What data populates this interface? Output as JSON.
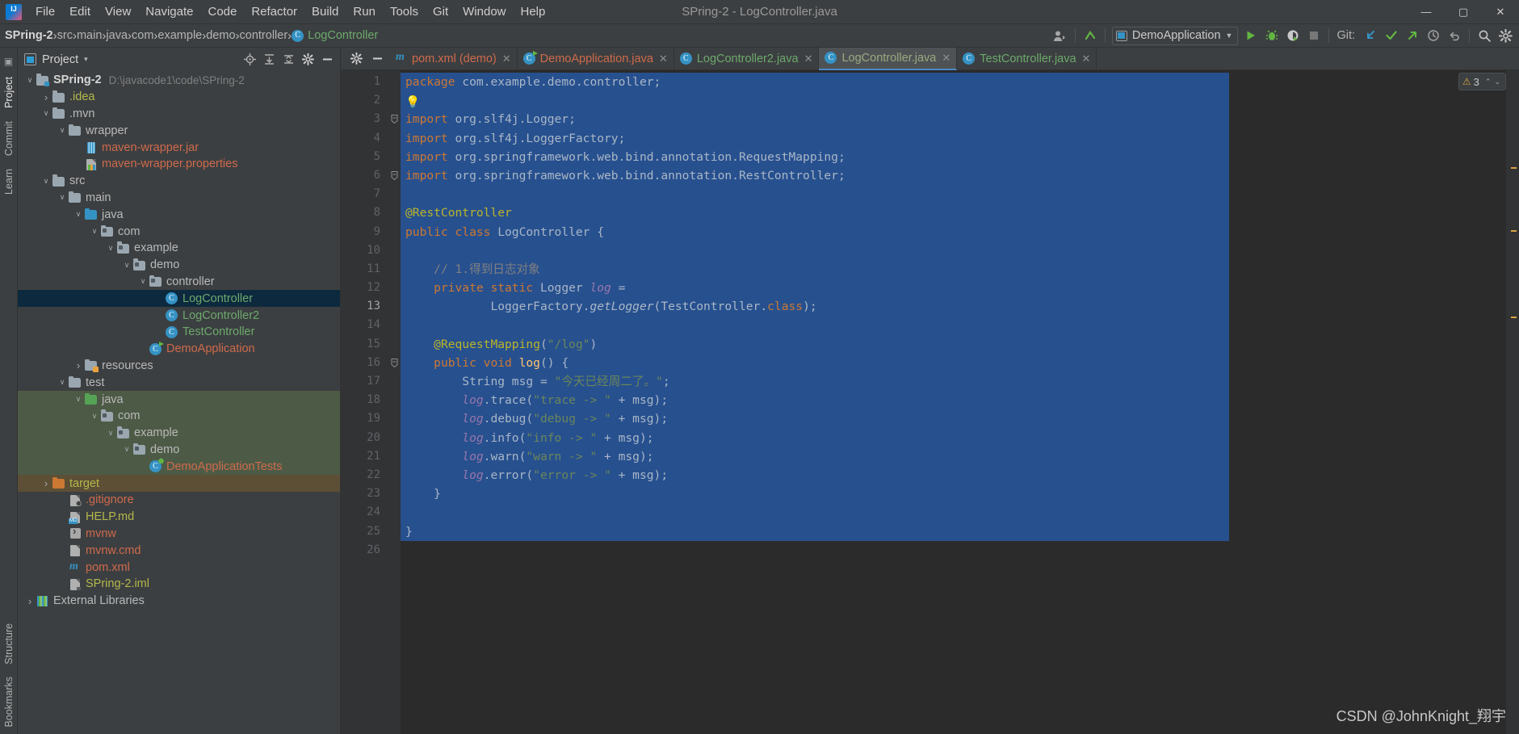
{
  "window": {
    "title": "SPring-2 - LogController.java",
    "minimize": "—",
    "maximize": "▢",
    "close": "✕"
  },
  "menubar": {
    "logo": "intellij-logo-icon",
    "items": [
      "File",
      "Edit",
      "View",
      "Navigate",
      "Code",
      "Refactor",
      "Build",
      "Run",
      "Tools",
      "Git",
      "Window",
      "Help"
    ]
  },
  "navbar": {
    "breadcrumbs": [
      "SPring-2",
      "src",
      "main",
      "java",
      "com",
      "example",
      "demo",
      "controller",
      "LogController"
    ],
    "separator": "›",
    "run_config": "DemoApplication",
    "git_label": "Git:",
    "icons": {
      "user": "user-avatar-icon",
      "updates": "updates-icon",
      "run": "run-icon",
      "debug": "debug-icon",
      "run_coverage": "run-with-coverage-icon",
      "stop": "stop-icon",
      "pull": "git-pull-icon",
      "commit": "git-commit-icon",
      "push": "git-push-icon",
      "history": "git-history-icon",
      "rollback": "git-rollback-icon",
      "search": "search-icon",
      "settings": "settings-gear-icon"
    }
  },
  "left_strip": {
    "top": [
      "Project",
      "Commit",
      "Learn"
    ],
    "bottom": [
      "Structure",
      "Bookmarks"
    ]
  },
  "project_panel": {
    "title": "Project",
    "caret": "▾",
    "header_icons": [
      "locate-icon",
      "expand-all-icon",
      "collapse-all-icon",
      "settings-gear-icon",
      "hide-icon"
    ],
    "tree": [
      {
        "depth": 0,
        "arrow": "⌄",
        "icon": "module-folder",
        "label": "SPring-2",
        "path": "D:\\javacode1\\code\\SPring-2",
        "color": "#d4d4d4",
        "bold": true,
        "state": "normal"
      },
      {
        "depth": 1,
        "arrow": "›",
        "icon": "folder",
        "label": ".idea",
        "path": "",
        "color": "#b5b84a",
        "bold": false,
        "state": "normal"
      },
      {
        "depth": 1,
        "arrow": "⌄",
        "icon": "folder",
        "label": ".mvn",
        "path": "",
        "color": "#b9b9b9",
        "bold": false,
        "state": "normal"
      },
      {
        "depth": 2,
        "arrow": "⌄",
        "icon": "folder",
        "label": "wrapper",
        "path": "",
        "color": "#b9b9b9",
        "bold": false,
        "state": "normal"
      },
      {
        "depth": 3,
        "arrow": "",
        "icon": "jar-file",
        "label": "maven-wrapper.jar",
        "path": "",
        "color": "#cf6a4c",
        "bold": false,
        "state": "normal"
      },
      {
        "depth": 3,
        "arrow": "",
        "icon": "properties-file",
        "label": "maven-wrapper.properties",
        "path": "",
        "color": "#cf6a4c",
        "bold": false,
        "state": "normal"
      },
      {
        "depth": 1,
        "arrow": "⌄",
        "icon": "folder",
        "label": "src",
        "path": "",
        "color": "#b9b9b9",
        "bold": false,
        "state": "normal"
      },
      {
        "depth": 2,
        "arrow": "⌄",
        "icon": "folder",
        "label": "main",
        "path": "",
        "color": "#b9b9b9",
        "bold": false,
        "state": "normal"
      },
      {
        "depth": 3,
        "arrow": "⌄",
        "icon": "source-folder",
        "label": "java",
        "path": "",
        "color": "#b9b9b9",
        "bold": false,
        "state": "normal"
      },
      {
        "depth": 4,
        "arrow": "⌄",
        "icon": "package",
        "label": "com",
        "path": "",
        "color": "#b9b9b9",
        "bold": false,
        "state": "normal"
      },
      {
        "depth": 5,
        "arrow": "⌄",
        "icon": "package",
        "label": "example",
        "path": "",
        "color": "#b9b9b9",
        "bold": false,
        "state": "normal"
      },
      {
        "depth": 6,
        "arrow": "⌄",
        "icon": "package",
        "label": "demo",
        "path": "",
        "color": "#b9b9b9",
        "bold": false,
        "state": "normal"
      },
      {
        "depth": 7,
        "arrow": "⌄",
        "icon": "package",
        "label": "controller",
        "path": "",
        "color": "#b9b9b9",
        "bold": false,
        "state": "normal"
      },
      {
        "depth": 8,
        "arrow": "",
        "icon": "java-class",
        "label": "LogController",
        "path": "",
        "color": "#6ca96c",
        "bold": false,
        "state": "selected"
      },
      {
        "depth": 8,
        "arrow": "",
        "icon": "java-class",
        "label": "LogController2",
        "path": "",
        "color": "#6ca96c",
        "bold": false,
        "state": "normal"
      },
      {
        "depth": 8,
        "arrow": "",
        "icon": "java-class",
        "label": "TestController",
        "path": "",
        "color": "#6ca96c",
        "bold": false,
        "state": "normal"
      },
      {
        "depth": 7,
        "arrow": "",
        "icon": "java-class-runnable",
        "label": "DemoApplication",
        "path": "",
        "color": "#cf6a4c",
        "bold": false,
        "state": "normal"
      },
      {
        "depth": 3,
        "arrow": "›",
        "icon": "resources-folder",
        "label": "resources",
        "path": "",
        "color": "#b9b9b9",
        "bold": false,
        "state": "normal"
      },
      {
        "depth": 2,
        "arrow": "⌄",
        "icon": "folder",
        "label": "test",
        "path": "",
        "color": "#b9b9b9",
        "bold": false,
        "state": "normal"
      },
      {
        "depth": 3,
        "arrow": "⌄",
        "icon": "test-source-folder",
        "label": "java",
        "path": "",
        "color": "#b9b9b9",
        "bold": false,
        "state": "testsrc"
      },
      {
        "depth": 4,
        "arrow": "⌄",
        "icon": "package",
        "label": "com",
        "path": "",
        "color": "#b9b9b9",
        "bold": false,
        "state": "testsrc"
      },
      {
        "depth": 5,
        "arrow": "⌄",
        "icon": "package",
        "label": "example",
        "path": "",
        "color": "#b9b9b9",
        "bold": false,
        "state": "testsrc"
      },
      {
        "depth": 6,
        "arrow": "⌄",
        "icon": "package",
        "label": "demo",
        "path": "",
        "color": "#b9b9b9",
        "bold": false,
        "state": "testsrc"
      },
      {
        "depth": 7,
        "arrow": "",
        "icon": "java-test-class",
        "label": "DemoApplicationTests",
        "path": "",
        "color": "#cf6a4c",
        "bold": false,
        "state": "testsrc"
      },
      {
        "depth": 1,
        "arrow": "›",
        "icon": "excluded-folder",
        "label": "target",
        "path": "",
        "color": "#b5b84a",
        "bold": false,
        "state": "target"
      },
      {
        "depth": 2,
        "arrow": "",
        "icon": "gitignore-file",
        "label": ".gitignore",
        "path": "",
        "color": "#cf6a4c",
        "bold": false,
        "state": "normal"
      },
      {
        "depth": 2,
        "arrow": "",
        "icon": "markdown-file",
        "label": "HELP.md",
        "path": "",
        "color": "#b5b84a",
        "bold": false,
        "state": "normal"
      },
      {
        "depth": 2,
        "arrow": "",
        "icon": "shell-file",
        "label": "mvnw",
        "path": "",
        "color": "#cf6a4c",
        "bold": false,
        "state": "normal"
      },
      {
        "depth": 2,
        "arrow": "",
        "icon": "cmd-file",
        "label": "mvnw.cmd",
        "path": "",
        "color": "#cf6a4c",
        "bold": false,
        "state": "normal"
      },
      {
        "depth": 2,
        "arrow": "",
        "icon": "maven-file",
        "label": "pom.xml",
        "path": "",
        "color": "#cf6a4c",
        "bold": false,
        "state": "normal"
      },
      {
        "depth": 2,
        "arrow": "",
        "icon": "iml-file",
        "label": "SPring-2.iml",
        "path": "",
        "color": "#b5b84a",
        "bold": false,
        "state": "normal"
      },
      {
        "depth": 0,
        "arrow": "›",
        "icon": "external-libraries",
        "label": "External Libraries",
        "path": "",
        "color": "#b9b9b9",
        "bold": false,
        "state": "normal"
      }
    ]
  },
  "editor": {
    "lead_icons": [
      "settings-gear-icon",
      "hide-panel-icon"
    ],
    "tabs": [
      {
        "label": "pom.xml (demo)",
        "icon": "maven-file-icon",
        "color": "#cf6a4c",
        "active": false,
        "close": "✕"
      },
      {
        "label": "DemoApplication.java",
        "icon": "java-class-runnable-icon",
        "color": "#cf6a4c",
        "active": false,
        "close": "✕"
      },
      {
        "label": "LogController2.java",
        "icon": "java-class-icon",
        "color": "#6ca96c",
        "active": false,
        "close": "✕"
      },
      {
        "label": "LogController.java",
        "icon": "java-class-icon",
        "color": "#9aa97f",
        "active": true,
        "close": "✕"
      },
      {
        "label": "TestController.java",
        "icon": "java-class-icon",
        "color": "#6ca96c",
        "active": false,
        "close": "✕"
      }
    ],
    "line_numbers": [
      1,
      2,
      3,
      4,
      5,
      6,
      7,
      8,
      9,
      10,
      11,
      12,
      13,
      14,
      15,
      16,
      17,
      18,
      19,
      20,
      21,
      22,
      23,
      24,
      25,
      26
    ],
    "current_line": 13,
    "warnings": {
      "icon": "warning-triangle-icon",
      "count": "3",
      "up": "⌃",
      "down": "⌄"
    },
    "code_lines": [
      {
        "n": 1,
        "html": "<span class='kw'>package</span> <span class='white'>com.example.demo.controller</span><span class='white'>;</span>"
      },
      {
        "n": 2,
        "html": "<span class='bulb'>💡</span>"
      },
      {
        "n": 3,
        "html": "<span class='kw'>import</span> <span class='white'>org.slf4j.Logger;</span>"
      },
      {
        "n": 4,
        "html": "<span class='kw'>import</span> <span class='white'>org.slf4j.LoggerFactory;</span>"
      },
      {
        "n": 5,
        "html": "<span class='kw'>import</span> <span class='white'>org.springframework.web.bind.annotation.RequestMapping;</span>"
      },
      {
        "n": 6,
        "html": "<span class='kw'>import</span> <span class='white'>org.springframework.web.bind.annotation.RestController;</span>"
      },
      {
        "n": 7,
        "html": ""
      },
      {
        "n": 8,
        "html": "<span class='ann'>@RestController</span>"
      },
      {
        "n": 9,
        "html": "<span class='kw'>public class</span> <span class='white'>LogController</span> {"
      },
      {
        "n": 10,
        "html": ""
      },
      {
        "n": 11,
        "html": "    <span class='cmt'>// 1.得到日志对象</span>"
      },
      {
        "n": 12,
        "html": "    <span class='kw'>private static</span> <span class='white'>Logger</span> <span class='fld'>log</span> ="
      },
      {
        "n": 13,
        "html": "            <span class='white'>LoggerFactory.</span><span class='stat'>getLogger</span><span class='white'>(TestController.</span><span class='kw'>class</span><span class='white'>);</span>"
      },
      {
        "n": 14,
        "html": ""
      },
      {
        "n": 15,
        "html": "    <span class='ann'>@RequestMapping</span>(<span class='str'>\"/log\"</span>)"
      },
      {
        "n": 16,
        "html": "    <span class='kw'>public void</span> <span class='mth'>log</span>() {"
      },
      {
        "n": 17,
        "html": "        <span class='white'>String msg = </span><span class='str'>\"今天已经周二了。\"</span><span class='white'>;</span>"
      },
      {
        "n": 18,
        "html": "        <span class='fld'>log</span><span class='white'>.trace(</span><span class='str'>\"trace -&gt; \"</span><span class='white'> + msg);</span>"
      },
      {
        "n": 19,
        "html": "        <span class='fld'>log</span><span class='white'>.debug(</span><span class='str'>\"debug -&gt; \"</span><span class='white'> + msg);</span>"
      },
      {
        "n": 20,
        "html": "        <span class='fld'>log</span><span class='white'>.info(</span><span class='str'>\"info -&gt; \"</span><span class='white'> + msg);</span>"
      },
      {
        "n": 21,
        "html": "        <span class='fld'>log</span><span class='white'>.warn(</span><span class='str'>\"warn -&gt; \"</span><span class='white'> + msg);</span>"
      },
      {
        "n": 22,
        "html": "        <span class='fld'>log</span><span class='white'>.error(</span><span class='str'>\"error -&gt; \"</span><span class='white'> + msg);</span>"
      },
      {
        "n": 23,
        "html": "    }"
      },
      {
        "n": 24,
        "html": ""
      },
      {
        "n": 25,
        "html": "}"
      },
      {
        "n": 26,
        "html": ""
      }
    ]
  },
  "watermark": "CSDN @JohnKnight_翔宇",
  "colors": {
    "accent_blue": "#3592c4",
    "selection_blue": "#27508f",
    "tree_selection": "#0d293e",
    "test_source": "#4d5b46",
    "excluded": "#5c4f36",
    "keyword_orange": "#cc7832",
    "string_green": "#6a8759",
    "annotation_yellow": "#bbb529",
    "field_purple": "#9876aa",
    "panel_bg": "#3c3f41",
    "editor_bg": "#2b2b2b",
    "gutter_bg": "#313335"
  }
}
